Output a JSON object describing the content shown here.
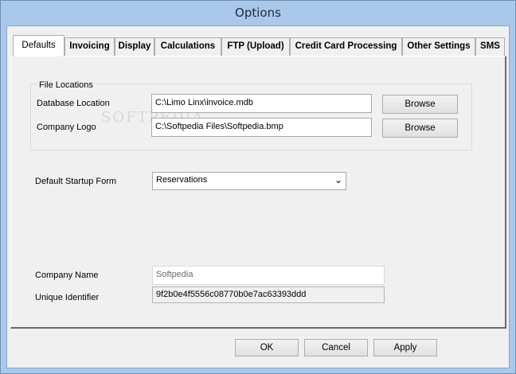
{
  "window": {
    "title": "Options"
  },
  "tabs": [
    {
      "label": "Defaults",
      "active": true
    },
    {
      "label": "Invoicing",
      "active": false
    },
    {
      "label": "Display",
      "active": false
    },
    {
      "label": "Calculations",
      "active": false
    },
    {
      "label": "FTP (Upload)",
      "active": false
    },
    {
      "label": "Credit Card Processing",
      "active": false
    },
    {
      "label": "Other Settings",
      "active": false
    },
    {
      "label": "SMS",
      "active": false
    }
  ],
  "file_locations": {
    "group_label": "File Locations",
    "database_location": {
      "label": "Database Location",
      "value": "C:\\Limo Linx\\invoice.mdb",
      "browse": "Browse"
    },
    "company_logo": {
      "label": "Company Logo",
      "value": "C:\\Softpedia Files\\Softpedia.bmp",
      "browse": "Browse"
    }
  },
  "startup": {
    "label": "Default Startup Form",
    "value": "Reservations"
  },
  "company": {
    "name_label": "Company Name",
    "name_value": "Softpedia",
    "id_label": "Unique Identifier",
    "id_value": "9f2b0e4f5556c08770b0e7ac63393ddd"
  },
  "watermark": "SOFTPEDIA",
  "buttons": {
    "ok": "OK",
    "cancel": "Cancel",
    "apply": "Apply"
  }
}
